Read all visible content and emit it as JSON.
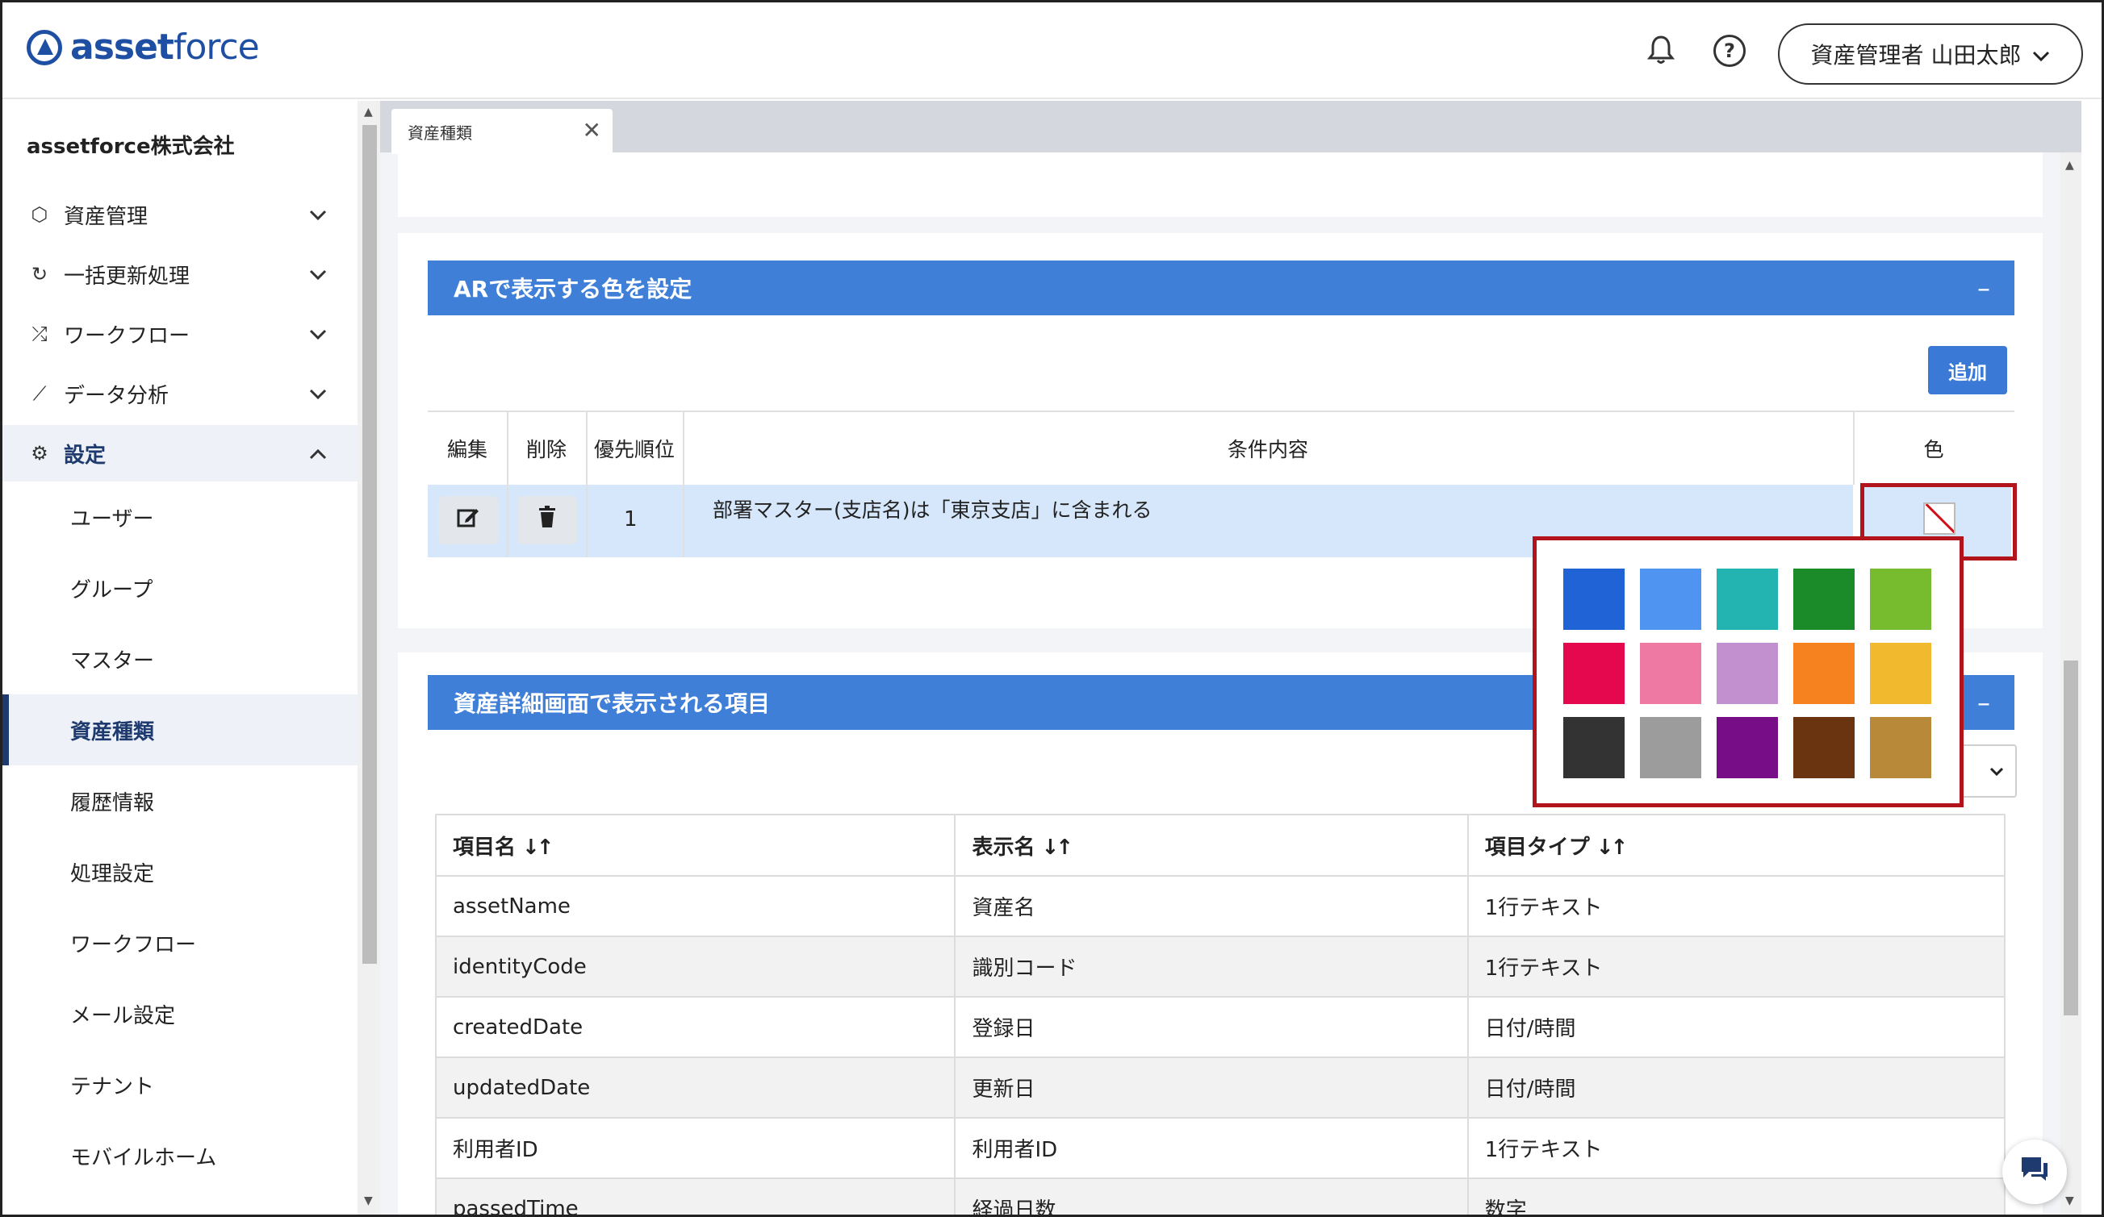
{
  "header": {
    "logo_bold": "asset",
    "logo_light": "force",
    "user_label": "資産管理者 山田太郎"
  },
  "sidebar": {
    "company": "assetforce株式会社",
    "groups": [
      {
        "label": "資産管理",
        "icon": "cube-icon"
      },
      {
        "label": "一括更新処理",
        "icon": "refresh-icon"
      },
      {
        "label": "ワークフロー",
        "icon": "workflow-icon"
      },
      {
        "label": "データ分析",
        "icon": "analytics-icon"
      },
      {
        "label": "設定",
        "icon": "gear-icon"
      }
    ],
    "settings_items": [
      "ユーザー",
      "グループ",
      "マスター",
      "資産種類",
      "履歴情報",
      "処理設定",
      "ワークフロー",
      "メール設定",
      "テナント",
      "モバイルホーム"
    ],
    "selected_item": "資産種類"
  },
  "tab": {
    "label": "資産種類"
  },
  "ar_section": {
    "title": "ARで表示する色を設定",
    "collapse": "–",
    "add_label": "追加",
    "columns": [
      "編集",
      "削除",
      "優先順位",
      "条件内容",
      "色"
    ],
    "row": {
      "priority": "1",
      "condition": "部署マスター(支店名)は「東京支店」に含まれる"
    },
    "palette": [
      "#1f63d6",
      "#4f94f0",
      "#23b3b1",
      "#1b8a28",
      "#77bc2e",
      "#e5084f",
      "#ee7aa3",
      "#c390cf",
      "#f6821f",
      "#f1b92e",
      "#333333",
      "#9c9c9c",
      "#770d87",
      "#6b3410",
      "#b9893a"
    ]
  },
  "detail_section": {
    "title": "資産詳細画面で表示される項目",
    "collapse": "–",
    "columns": [
      "項目名",
      "表示名",
      "項目タイプ"
    ],
    "sort_icon": "↓↑",
    "rows": [
      [
        "assetName",
        "資産名",
        "1行テキスト"
      ],
      [
        "identityCode",
        "識別コード",
        "1行テキスト"
      ],
      [
        "createdDate",
        "登録日",
        "日付/時間"
      ],
      [
        "updatedDate",
        "更新日",
        "日付/時間"
      ],
      [
        "利用者ID",
        "利用者ID",
        "1行テキスト"
      ],
      [
        "passedTime",
        "経過日数",
        "数字"
      ]
    ]
  }
}
